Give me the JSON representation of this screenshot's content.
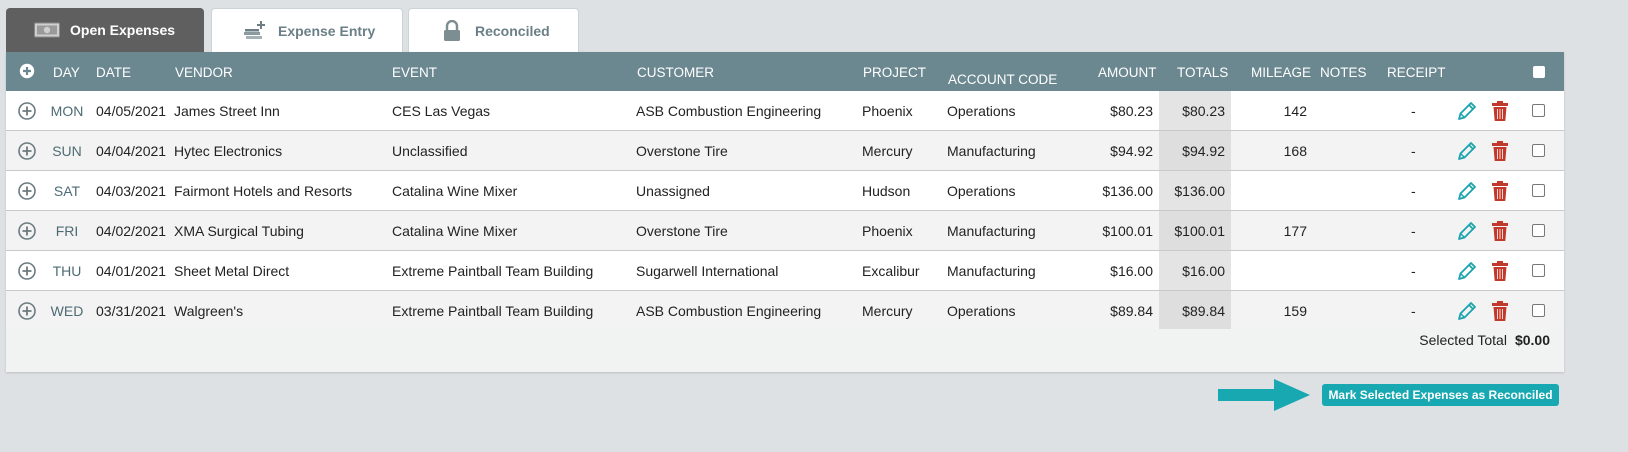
{
  "tabs": [
    {
      "label": "Open Expenses",
      "icon": "cash-icon",
      "active": true
    },
    {
      "label": "Expense Entry",
      "icon": "add-money-icon",
      "active": false
    },
    {
      "label": "Reconciled",
      "icon": "lock-icon",
      "active": false
    }
  ],
  "table": {
    "headers": {
      "day": "DAY",
      "date": "DATE",
      "vendor": "VENDOR",
      "event": "EVENT",
      "customer": "CUSTOMER",
      "project": "PROJECT",
      "account_code": "ACCOUNT CODE",
      "amount": "AMOUNT",
      "totals": "TOTALS",
      "mileage": "MILEAGE",
      "notes": "NOTES",
      "receipt": "RECEIPT"
    },
    "rows": [
      {
        "day": "MON",
        "date": "04/05/2021",
        "vendor": "James Street Inn",
        "event": "CES Las Vegas",
        "customer": "ASB Combustion Engineering",
        "project": "Phoenix",
        "account_code": "Operations",
        "amount": "$80.23",
        "total": "$80.23",
        "mileage": "142",
        "receipt": "-"
      },
      {
        "day": "SUN",
        "date": "04/04/2021",
        "vendor": "Hytec Electronics",
        "event": "Unclassified",
        "customer": "Overstone Tire",
        "project": "Mercury",
        "account_code": "Manufacturing",
        "amount": "$94.92",
        "total": "$94.92",
        "mileage": "168",
        "receipt": "-"
      },
      {
        "day": "SAT",
        "date": "04/03/2021",
        "vendor": "Fairmont Hotels and Resorts",
        "event": "Catalina Wine Mixer",
        "customer": "Unassigned",
        "project": "Hudson",
        "account_code": "Operations",
        "amount": "$136.00",
        "total": "$136.00",
        "mileage": "",
        "receipt": "-"
      },
      {
        "day": "FRI",
        "date": "04/02/2021",
        "vendor": "XMA Surgical Tubing",
        "event": "Catalina Wine Mixer",
        "customer": "Overstone Tire",
        "project": "Phoenix",
        "account_code": "Manufacturing",
        "amount": "$100.01",
        "total": "$100.01",
        "mileage": "177",
        "receipt": "-"
      },
      {
        "day": "THU",
        "date": "04/01/2021",
        "vendor": "Sheet Metal Direct",
        "event": "Extreme Paintball Team Building",
        "customer": "Sugarwell International",
        "project": "Excalibur",
        "account_code": "Manufacturing",
        "amount": "$16.00",
        "total": "$16.00",
        "mileage": "",
        "receipt": "-"
      },
      {
        "day": "WED",
        "date": "03/31/2021",
        "vendor": "Walgreen's",
        "event": "Extreme Paintball Team Building",
        "customer": "ASB Combustion Engineering",
        "project": "Mercury",
        "account_code": "Operations",
        "amount": "$89.84",
        "total": "$89.84",
        "mileage": "159",
        "receipt": "-"
      }
    ]
  },
  "footer": {
    "selected_total_label": "Selected Total",
    "selected_total_value": "$0.00"
  },
  "actions": {
    "mark_reconciled_label": "Mark Selected Expenses as Reconciled"
  },
  "colors": {
    "header_bg": "#6b8891",
    "accent": "#17a8b1",
    "edit_icon": "#1aa3ad",
    "delete_icon": "#c0392b"
  }
}
